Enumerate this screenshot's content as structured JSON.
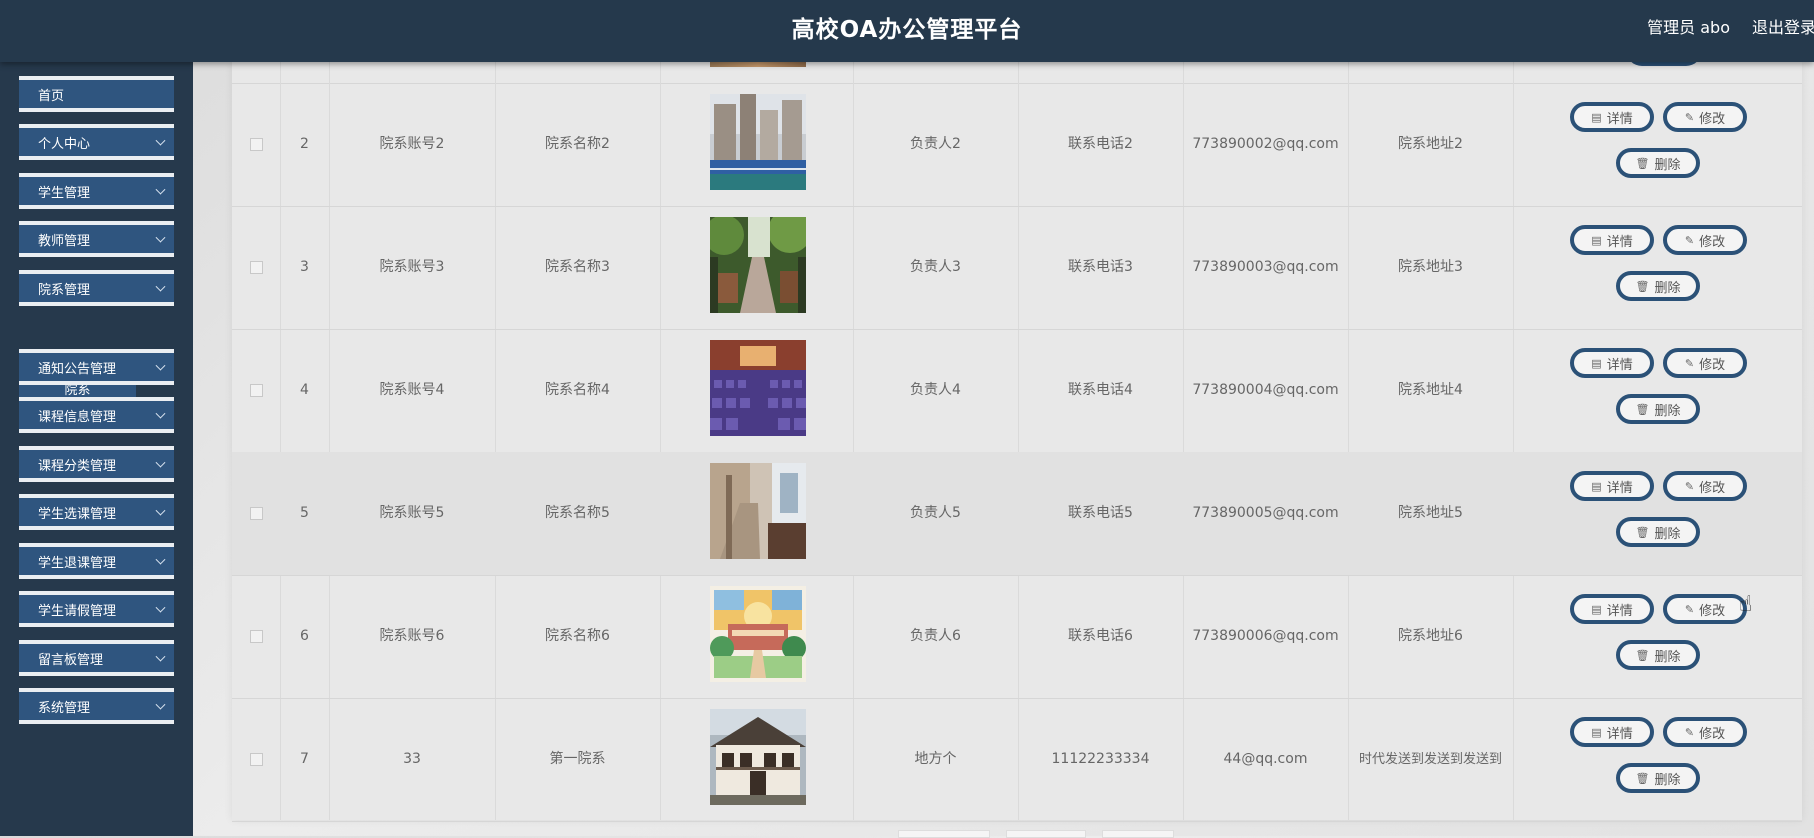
{
  "header": {
    "title": "高校OA办公管理平台",
    "user": "管理员 abo",
    "logout": "退出登录"
  },
  "sidebar": {
    "items": [
      {
        "label": "首页"
      },
      {
        "label": "个人中心"
      },
      {
        "label": "学生管理"
      },
      {
        "label": "教师管理"
      },
      {
        "label": "院系管理"
      },
      {
        "label": "通知公告管理"
      },
      {
        "label": "课程信息管理"
      },
      {
        "label": "课程分类管理"
      },
      {
        "label": "学生选课管理"
      },
      {
        "label": "学生退课管理"
      },
      {
        "label": "学生请假管理"
      },
      {
        "label": "留言板管理"
      },
      {
        "label": "系统管理"
      }
    ],
    "sub_item": "院系"
  },
  "table": {
    "actions": {
      "detail": "详情",
      "edit": "修改",
      "delete": "删除"
    },
    "rows": [
      {
        "index": "2",
        "account": "院系账号2",
        "name": "院系名称2",
        "leader": "负责人2",
        "phone": "联系电话2",
        "email": "773890002@qq.com",
        "address": "院系地址2",
        "image": "campus-track-photo"
      },
      {
        "index": "3",
        "account": "院系账号3",
        "name": "院系名称3",
        "leader": "负责人3",
        "phone": "联系电话3",
        "email": "773890003@qq.com",
        "address": "院系地址3",
        "image": "garden-path-photo"
      },
      {
        "index": "4",
        "account": "院系账号4",
        "name": "院系名称4",
        "leader": "负责人4",
        "phone": "联系电话4",
        "email": "773890004@qq.com",
        "address": "院系地址4",
        "image": "lecture-hall-photo"
      },
      {
        "index": "5",
        "account": "院系账号5",
        "name": "院系名称5",
        "leader": "负责人5",
        "phone": "联系电话5",
        "email": "773890005@qq.com",
        "address": "院系地址5",
        "image": "corridor-photo"
      },
      {
        "index": "6",
        "account": "院系账号6",
        "name": "院系名称6",
        "leader": "负责人6",
        "phone": "联系电话6",
        "email": "773890006@qq.com",
        "address": "院系地址6",
        "image": "watercolor-campus-photo"
      },
      {
        "index": "7",
        "account": "33",
        "name": "第一院系",
        "leader": "地方个",
        "phone": "11122233334",
        "email": "44@qq.com",
        "address": "时代发送到发送到发送到",
        "image": "old-building-photo"
      }
    ]
  }
}
